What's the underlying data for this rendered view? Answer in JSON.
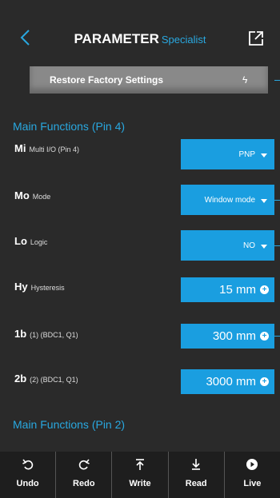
{
  "header": {
    "title": "PARAMETER",
    "subtitle": "Specialist"
  },
  "restore": {
    "label": "Restore Factory Settings",
    "icon": "lightning-icon"
  },
  "sections": {
    "main_pin4": "Main Functions (Pin 4)",
    "main_pin2": "Main Functions (Pin 2)"
  },
  "rows": [
    {
      "code": "Mi",
      "desc": "Multi I/O (Pin 4)",
      "value": "PNP",
      "type": "dropdown"
    },
    {
      "code": "Mo",
      "desc": "Mode",
      "value": "Window mode",
      "type": "dropdown"
    },
    {
      "code": "Lo",
      "desc": "Logic",
      "value": "NO",
      "type": "dropdown"
    },
    {
      "code": "Hy",
      "desc": "Hysteresis",
      "value": "15 mm",
      "type": "number"
    },
    {
      "code": "1b",
      "desc": "(1) (BDC1, Q1)",
      "value": "300 mm",
      "type": "number"
    },
    {
      "code": "2b",
      "desc": "(2) (BDC1, Q1)",
      "value": "3000 mm",
      "type": "number"
    }
  ],
  "footer": {
    "undo": "Undo",
    "redo": "Redo",
    "write": "Write",
    "read": "Read",
    "live": "Live"
  },
  "colors": {
    "background": "#2a2a2a",
    "accent": "#1a9ee0",
    "section_text": "#29a8e0",
    "restore_button": "#898989",
    "footer": "#1e1e1e"
  }
}
